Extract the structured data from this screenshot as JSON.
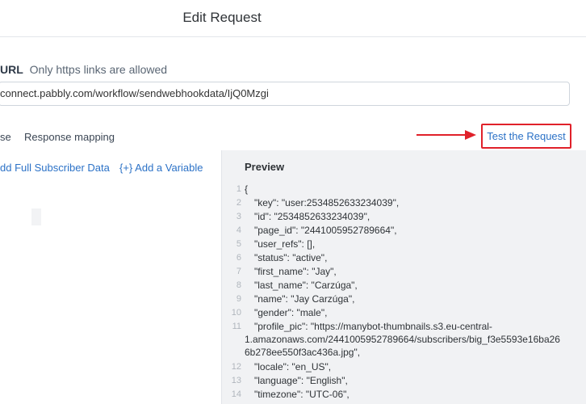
{
  "header": {
    "title": "Edit Request"
  },
  "url_section": {
    "label": "URL",
    "hint": "Only https links are allowed",
    "value": "connect.pabbly.com/workflow/sendwebhookdata/IjQ0Mzgi"
  },
  "tabs": [
    {
      "label": "se"
    },
    {
      "label": "Response mapping"
    }
  ],
  "test_button": {
    "label": "Test the Request"
  },
  "left_panel": {
    "add_subscriber_label": "dd Full Subscriber Data",
    "add_variable_label": "{+} Add a Variable"
  },
  "preview": {
    "title": "Preview",
    "lines": [
      {
        "num": "1",
        "text": "{"
      },
      {
        "num": "2",
        "text": "\"key\": \"user:2534852633234039\","
      },
      {
        "num": "3",
        "text": "\"id\": \"2534852633234039\","
      },
      {
        "num": "4",
        "text": "\"page_id\": \"2441005952789664\","
      },
      {
        "num": "5",
        "text": "\"user_refs\": [],"
      },
      {
        "num": "6",
        "text": "\"status\": \"active\","
      },
      {
        "num": "7",
        "text": "\"first_name\": \"Jay\","
      },
      {
        "num": "8",
        "text": "\"last_name\": \"Carzúga\","
      },
      {
        "num": "9",
        "text": "\"name\": \"Jay Carzúga\","
      },
      {
        "num": "10",
        "text": "\"gender\": \"male\","
      },
      {
        "num": "11",
        "text_parts": [
          "\"profile_pic\": \"https://manybot-thumbnails.s3.eu-central-",
          "1.amazonaws.com/2441005952789664/subscribers/big_f3e5593e16ba26",
          "6b278ee550f3ac436a.jpg\","
        ]
      },
      {
        "num": "12",
        "text": "\"locale\": \"en_US\","
      },
      {
        "num": "13",
        "text": "\"language\": \"English\","
      },
      {
        "num": "14",
        "text": "\"timezone\": \"UTC-06\","
      }
    ]
  },
  "colors": {
    "accent": "#2c72c7",
    "highlight": "#e0212a",
    "preview_bg": "#f1f2f4"
  }
}
